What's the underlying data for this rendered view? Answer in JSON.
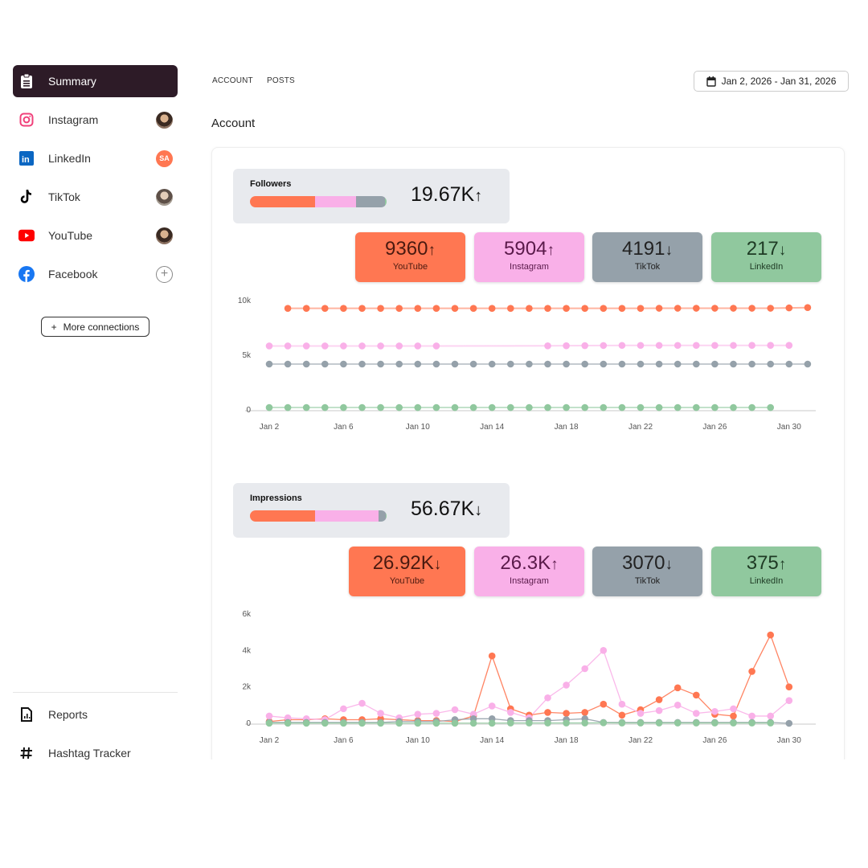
{
  "colors": {
    "youtube": "#ff7752",
    "instagram": "#f9b0e8",
    "tiktok": "#95a1aa",
    "linkedin": "#90c89e",
    "active": "#2d1b27"
  },
  "sidebar": {
    "items": [
      {
        "label": "Summary",
        "icon": "clipboard-icon"
      },
      {
        "label": "Instagram",
        "icon": "instagram-icon",
        "avatar": "photo"
      },
      {
        "label": "LinkedIn",
        "icon": "linkedin-icon",
        "avatar": "SA"
      },
      {
        "label": "TikTok",
        "icon": "tiktok-icon",
        "avatar": "photo"
      },
      {
        "label": "YouTube",
        "icon": "youtube-icon",
        "avatar": "photo"
      },
      {
        "label": "Facebook",
        "icon": "facebook-icon",
        "avatar": "add"
      }
    ],
    "more_connections": "More connections",
    "bottom": [
      {
        "label": "Reports",
        "icon": "report-icon"
      },
      {
        "label": "Hashtag Tracker",
        "icon": "hashtag-icon"
      }
    ]
  },
  "tabs": [
    "ACCOUNT",
    "POSTS"
  ],
  "date_range": "Jan 2, 2026 - Jan 31, 2026",
  "section_title": "Account",
  "followers": {
    "title": "Followers",
    "total": "19.67K",
    "total_trend": "up",
    "platforms": [
      {
        "name": "YouTube",
        "value": "9360",
        "trend": "up"
      },
      {
        "name": "Instagram",
        "value": "5904",
        "trend": "up"
      },
      {
        "name": "TikTok",
        "value": "4191",
        "trend": "down"
      },
      {
        "name": "LinkedIn",
        "value": "217",
        "trend": "down"
      }
    ]
  },
  "impressions": {
    "title": "Impressions",
    "total": "56.67K",
    "total_trend": "down",
    "platforms": [
      {
        "name": "YouTube",
        "value": "26.92K",
        "trend": "down"
      },
      {
        "name": "Instagram",
        "value": "26.3K",
        "trend": "up"
      },
      {
        "name": "TikTok",
        "value": "3070",
        "trend": "down"
      },
      {
        "name": "LinkedIn",
        "value": "375",
        "trend": "up"
      }
    ]
  },
  "chart_data": [
    {
      "type": "line",
      "x_start": "Jan 2",
      "x_ticks": [
        "Jan 2",
        "Jan 6",
        "Jan 10",
        "Jan 14",
        "Jan 18",
        "Jan 22",
        "Jan 26",
        "Jan 30"
      ],
      "y_ticks": [
        "0",
        "5k",
        "10k"
      ],
      "ylim": [
        0,
        10000
      ],
      "grid": false,
      "series": [
        {
          "values": [
            null,
            9290,
            9290,
            9290,
            9290,
            9290,
            9290,
            9290,
            9290,
            9290,
            9290,
            9290,
            9290,
            9290,
            9290,
            9290,
            9290,
            9290,
            9290,
            9290,
            9290,
            9300,
            9300,
            9300,
            9300,
            9300,
            9300,
            9300,
            9330,
            9360
          ]
        },
        {
          "values": [
            5850,
            5850,
            5850,
            5850,
            5850,
            5850,
            5850,
            5850,
            5850,
            5850,
            null,
            null,
            null,
            null,
            null,
            5860,
            5870,
            5880,
            5890,
            5900,
            5900,
            5900,
            5900,
            5900,
            5900,
            5900,
            5904,
            5904,
            5904,
            null
          ]
        },
        {
          "values": [
            4191,
            4191,
            4191,
            4191,
            4191,
            4191,
            4191,
            4191,
            4191,
            4191,
            4191,
            4191,
            4191,
            4191,
            4191,
            4191,
            4191,
            4191,
            4191,
            4191,
            4191,
            4191,
            4191,
            4191,
            4191,
            4191,
            4191,
            4191,
            4191,
            4191
          ]
        },
        {
          "values": [
            217,
            217,
            217,
            217,
            217,
            217,
            217,
            217,
            217,
            217,
            217,
            217,
            217,
            217,
            217,
            217,
            217,
            217,
            217,
            217,
            217,
            217,
            217,
            217,
            217,
            217,
            217,
            217,
            null,
            null
          ]
        }
      ]
    },
    {
      "type": "line",
      "x_start": "Jan 2",
      "x_ticks": [
        "Jan 2",
        "Jan 6",
        "Jan 10",
        "Jan 14",
        "Jan 18",
        "Jan 22",
        "Jan 26",
        "Jan 30"
      ],
      "y_ticks": [
        "0",
        "2k",
        "4k",
        "6k"
      ],
      "ylim": [
        0,
        6000
      ],
      "grid": false,
      "series": [
        {
          "values": [
            100,
            200,
            200,
            250,
            200,
            200,
            250,
            200,
            150,
            150,
            100,
            400,
            3700,
            800,
            450,
            600,
            550,
            600,
            1050,
            450,
            750,
            1300,
            1950,
            1550,
            500,
            400,
            2850,
            4850,
            2000
          ]
        },
        {
          "values": [
            400,
            300,
            250,
            200,
            800,
            1100,
            550,
            300,
            500,
            550,
            750,
            500,
            950,
            600,
            300,
            1400,
            2100,
            3000,
            4000,
            1050,
            550,
            700,
            1000,
            550,
            650,
            800,
            400,
            400,
            1250
          ]
        },
        {
          "values": [
            50,
            50,
            50,
            50,
            50,
            50,
            50,
            100,
            100,
            100,
            200,
            250,
            250,
            150,
            150,
            150,
            200,
            250,
            50,
            50,
            50,
            50,
            50,
            50,
            50,
            50,
            50,
            50,
            0
          ]
        },
        {
          "values": [
            10,
            10,
            10,
            10,
            10,
            10,
            10,
            10,
            10,
            10,
            10,
            10,
            10,
            20,
            20,
            20,
            20,
            20,
            30,
            20,
            20,
            20,
            20,
            20,
            20,
            20,
            20,
            20,
            null
          ]
        }
      ]
    }
  ]
}
